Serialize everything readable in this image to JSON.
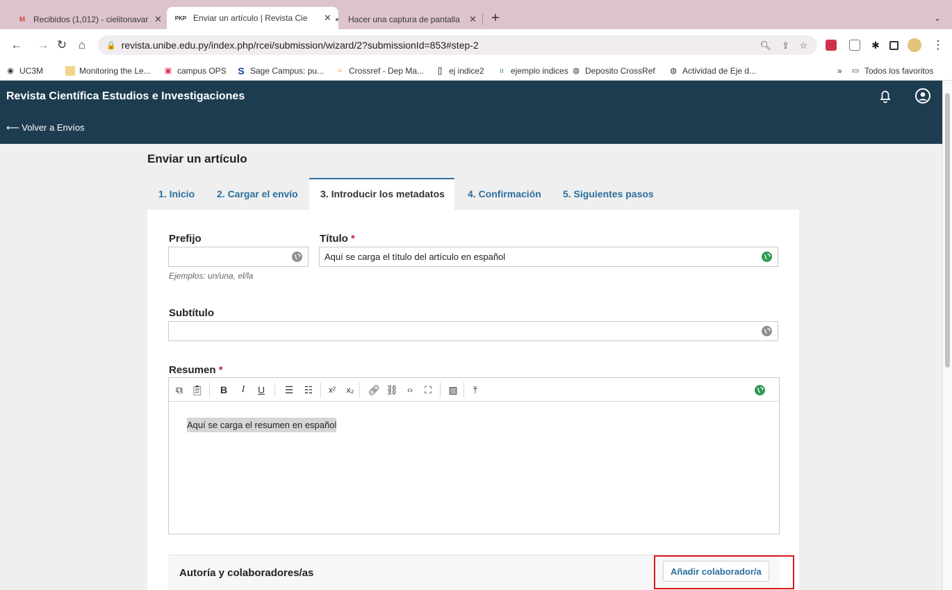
{
  "browser": {
    "tabs": [
      {
        "label": "Recibidos (1,012) - cielitonavar",
        "icon": "gmail-icon"
      },
      {
        "label": "Enviar un artículo | Revista Cie",
        "icon": "pkp-icon",
        "icon_text": "PKP"
      },
      {
        "label": "Hacer una captura de pantalla",
        "icon": "apple-icon"
      }
    ],
    "url": "revista.unibe.edu.py/index.php/rcei/submission/wizard/2?submissionId=853#step-2",
    "bookmarks": [
      "UC3M",
      "Monitoring the Le...",
      "campus OPS",
      "Sage Campus: pu...",
      "Crossref - Dep Ma...",
      "ej indice2",
      "ejemplo indices",
      "Deposito CrossRef",
      "Actividad de Eje d..."
    ],
    "all_bookmarks": "Todos los favoritos",
    "overflow": "»"
  },
  "app": {
    "journal_title": "Revista Científica Estudios e Investigaciones",
    "back_link": "⟵ Volver a Envíos"
  },
  "page": {
    "title": "Enviar un artículo",
    "steps": [
      "1. Inicio",
      "2. Cargar el envío",
      "3. Introducir los metadatos",
      "4. Confirmación",
      "5. Siguientes pasos"
    ],
    "active_step": 2
  },
  "form": {
    "prefix": {
      "label": "Prefijo",
      "value": "",
      "hint": "Ejemplos: un/una, el/la"
    },
    "title": {
      "label": "Título",
      "required": "*",
      "value": "Aquí se carga el título del artículo en español"
    },
    "subtitle": {
      "label": "Subtítulo",
      "value": ""
    },
    "abstract": {
      "label": "Resumen",
      "required": "*",
      "value": "Aquí se carga el resumen en español"
    },
    "authors": {
      "title": "Autoría y colaboradores/as",
      "add_button": "Añadir colaborador/a"
    }
  },
  "colors": {
    "header_bg": "#1e3c50",
    "link": "#2c6e9c",
    "required": "#c61e52",
    "highlight": "#d81a1a",
    "globe_filled": "#2f9a54",
    "globe_empty": "#8f8f8f"
  }
}
